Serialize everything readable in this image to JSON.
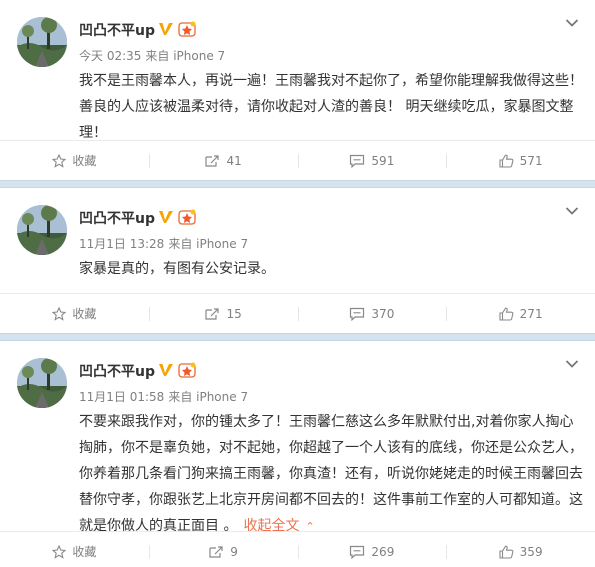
{
  "posts": [
    {
      "author": "凹凸不平up",
      "time": "今天 02:35",
      "source": "来自 iPhone 7",
      "content": "我不是王雨馨本人，再说一遍！王雨馨我对不起你了，希望你能理解我做得这些！善良的人应该被温柔对待，请你收起对人渣的善良！ 明天继续吃瓜，家暴图文整理！",
      "actions": {
        "favorite": "收藏",
        "repost": "41",
        "comment": "591",
        "like": "571"
      }
    },
    {
      "author": "凹凸不平up",
      "time": "11月1日 13:28",
      "source": "来自 iPhone 7",
      "content": "家暴是真的，有图有公安记录。",
      "actions": {
        "favorite": "收藏",
        "repost": "15",
        "comment": "370",
        "like": "271"
      }
    },
    {
      "author": "凹凸不平up",
      "time": "11月1日 01:58",
      "source": "来自 iPhone 7",
      "content": "不要来跟我作对，你的锺太多了！王雨馨仁慈这么多年默默付出,对着你家人掏心掏肺，你不是辜负她，对不起她，你超越了一个人该有的底线，你还是公众艺人，你养着那几条看门狗来搞王雨馨，你真渣！还有，听说你姥姥走的时候王雨馨回去替你守孝，你跟张艺上北京开房间都不回去的！这件事前工作室的人可都知道。这就是你做人的真正面目 。",
      "collapse_label": "收起全文",
      "actions": {
        "favorite": "收藏",
        "repost": "9",
        "comment": "269",
        "like": "359"
      }
    }
  ],
  "colors": {
    "verified_orange": "#f7a400",
    "collapse_link": "#eb7350",
    "separator": "#d5e3ee"
  }
}
